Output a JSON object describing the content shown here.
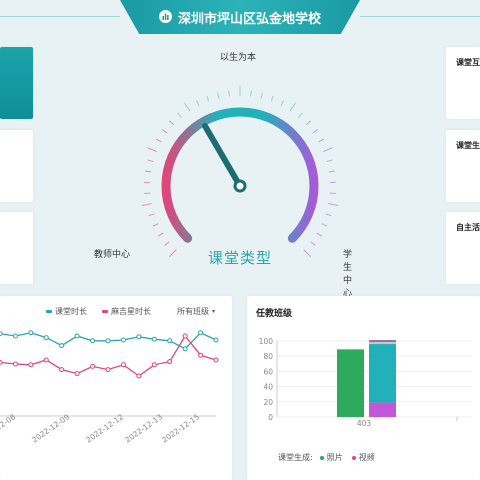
{
  "header": {
    "title": "深圳市坪山区弘金地学校",
    "icon": "bar-chart-icon"
  },
  "gauge": {
    "top_label": "以生为本",
    "left_label": "教师中心",
    "right_label": "学生中心",
    "center_label": "课堂类型"
  },
  "right_cards": [
    {
      "title": "课堂互"
    },
    {
      "title": "课堂生"
    },
    {
      "title": "自主活"
    }
  ],
  "line_chart": {
    "legend": [
      {
        "label": "课堂时长",
        "color": "#2aa6b0"
      },
      {
        "label": "麻吉星时长",
        "color": "#e0457b"
      }
    ],
    "filter_label": "所有班级",
    "filter_arrow": "▾"
  },
  "bar_card": {
    "title": "任教班级",
    "legend_title": "课堂生成:",
    "legend": [
      {
        "label": "照片",
        "color": "#2eaa5e"
      },
      {
        "label": "视频",
        "color": "#e0457b"
      }
    ]
  },
  "chart_data": [
    {
      "type": "line",
      "x_tick_labels": [
        "2022-12-08",
        "2022-12-09",
        "2022-12-12",
        "2022-12-13",
        "2022-12-15"
      ],
      "series": [
        {
          "name": "课堂时长",
          "color": "#2aa6b0",
          "values": [
            103,
            100,
            104,
            98,
            88,
            100,
            94,
            94,
            95,
            99,
            96,
            94,
            84,
            104,
            95
          ]
        },
        {
          "name": "麻吉星时长",
          "color": "#e0457b",
          "values": [
            67,
            65,
            64,
            70,
            58,
            53,
            62,
            58,
            64,
            50,
            64,
            68,
            100,
            76,
            70
          ]
        }
      ]
    },
    {
      "type": "bar",
      "stacked": true,
      "categories": [
        "403"
      ],
      "ylim": [
        0,
        100
      ],
      "yticks": [
        0,
        20,
        40,
        60,
        80,
        100
      ],
      "bars": [
        {
          "segments": [
            {
              "value": 89,
              "color": "#2eaa5e"
            }
          ]
        },
        {
          "segments": [
            {
              "value": 19,
              "color": "#c456d8"
            },
            {
              "value": 77,
              "color": "#22b1b8"
            },
            {
              "value": 3,
              "color": "#c7c7cf"
            },
            {
              "value": 2,
              "color": "#7b4f8a"
            }
          ]
        }
      ]
    }
  ]
}
